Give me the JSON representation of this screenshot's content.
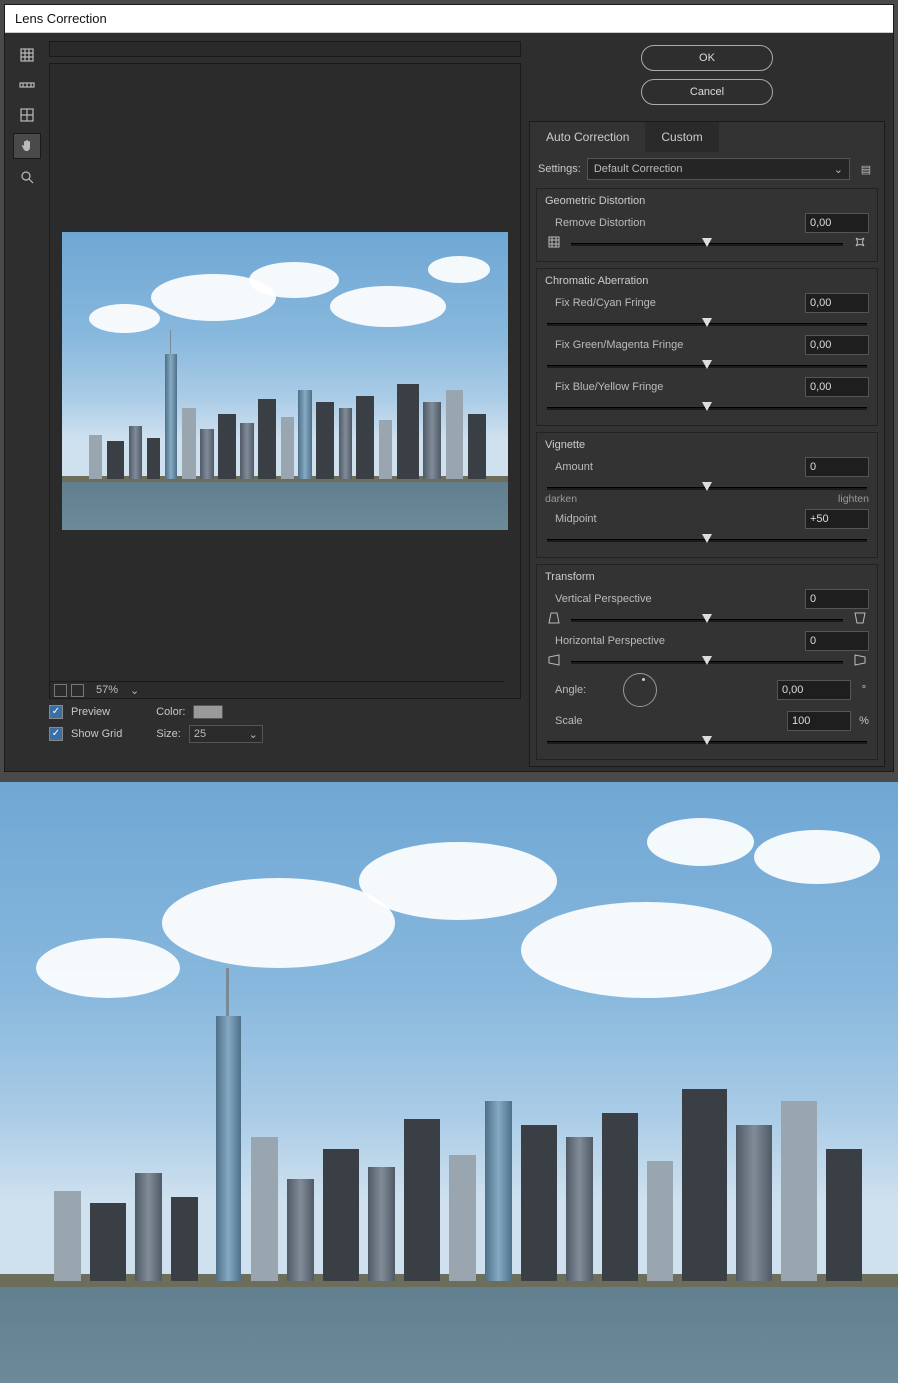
{
  "dialog": {
    "title": "Lens Correction",
    "ok": "OK",
    "cancel": "Cancel",
    "zoom": "57%",
    "preview_chk": "Preview",
    "grid_chk": "Show Grid",
    "color_lbl": "Color:",
    "size_lbl": "Size:",
    "size_val": "25"
  },
  "tabs": {
    "auto": "Auto Correction",
    "custom": "Custom"
  },
  "settings": {
    "label": "Settings:",
    "value": "Default Correction"
  },
  "geo": {
    "title": "Geometric Distortion",
    "remove": "Remove Distortion",
    "remove_val": "0,00"
  },
  "ca": {
    "title": "Chromatic Aberration",
    "red": "Fix Red/Cyan Fringe",
    "red_val": "0,00",
    "green": "Fix Green/Magenta Fringe",
    "green_val": "0,00",
    "blue": "Fix Blue/Yellow Fringe",
    "blue_val": "0,00"
  },
  "vig": {
    "title": "Vignette",
    "amount": "Amount",
    "amount_val": "0",
    "min": "darken",
    "max": "lighten",
    "mid": "Midpoint",
    "mid_val": "+50"
  },
  "tf": {
    "title": "Transform",
    "vpersp": "Vertical Perspective",
    "vpersp_val": "0",
    "hpersp": "Horizontal Perspective",
    "hpersp_val": "0",
    "angle": "Angle:",
    "angle_val": "0,00",
    "angle_unit": "°",
    "scale": "Scale",
    "scale_val": "100",
    "scale_unit": "%"
  }
}
